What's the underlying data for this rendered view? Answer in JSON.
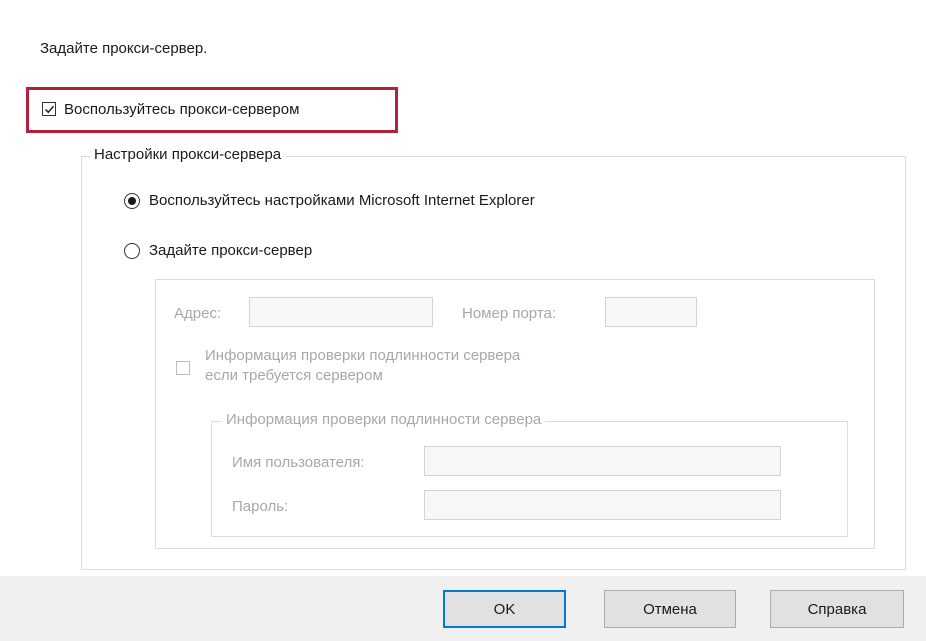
{
  "dialog": {
    "heading": "Задайте прокси-сервер.",
    "use_proxy": {
      "label": "Воспользуйтесь прокси-сервером",
      "checked": true
    }
  },
  "proxy_settings": {
    "legend": "Настройки прокси-сервера",
    "option_ie": {
      "label": "Воспользуйтесь настройками Microsoft Internet Explorer",
      "selected": true
    },
    "option_manual": {
      "label": "Задайте прокси-сервер",
      "selected": false
    }
  },
  "manual": {
    "address_label": "Адрес:",
    "address_value": "",
    "port_label": "Номер порта:",
    "port_value": "",
    "auth_required_line1": "Информация проверки подлинности сервера",
    "auth_required_line2": "если требуется сервером",
    "auth_required_checked": false
  },
  "auth": {
    "legend": "Информация проверки подлинности сервера",
    "username_label": "Имя пользователя:",
    "username_value": "",
    "password_label": "Пароль:",
    "password_value": ""
  },
  "buttons": {
    "ok": "OK",
    "cancel": "Отмена",
    "help": "Справка"
  },
  "colors": {
    "highlight_border": "#b41f3a",
    "disabled_text": "#a8a8a8",
    "footer_bg": "#f0f0f0"
  }
}
